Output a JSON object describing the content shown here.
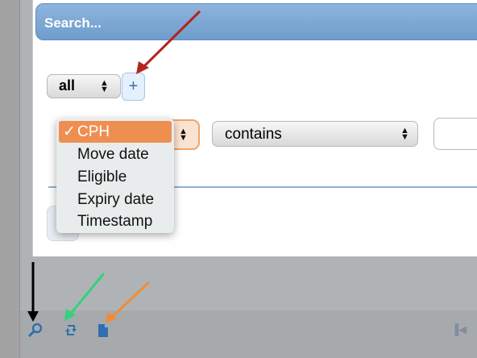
{
  "search": {
    "title": "Search..."
  },
  "group_select": {
    "value": "all"
  },
  "add_button": {
    "label": "+"
  },
  "field_select": {
    "options": [
      "CPH",
      "Move date",
      "Eligible",
      "Expiry date",
      "Timestamp"
    ],
    "selected": "CPH",
    "check": "✓"
  },
  "operator_select": {
    "value": "contains"
  },
  "toolbar": {
    "icons": [
      "search-icon",
      "refresh-icon",
      "document-icon",
      "last-page-icon"
    ]
  },
  "annotations": {
    "arrow_colors": [
      "#b3261e",
      "#000000",
      "#33d17a",
      "#f08c36"
    ]
  }
}
